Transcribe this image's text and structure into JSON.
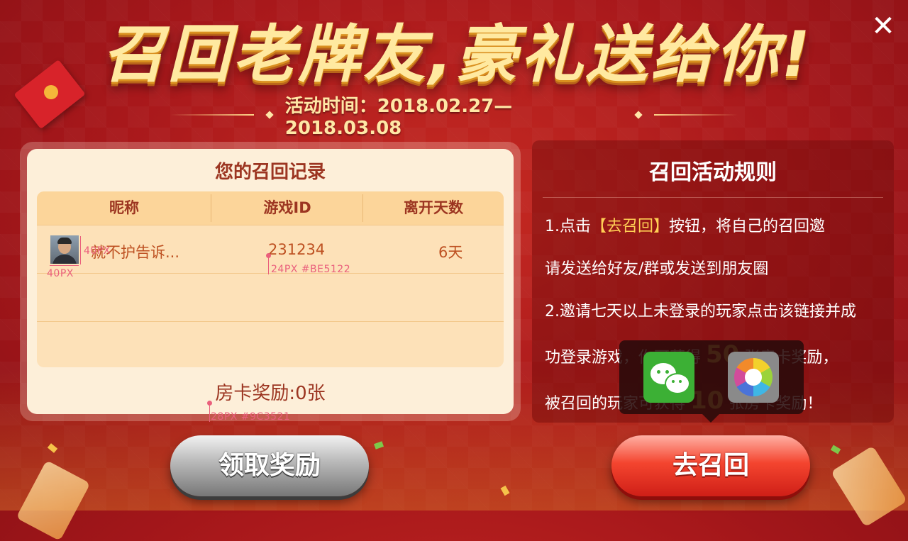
{
  "header": {
    "headline": "召回老牌友,豪礼送给你!",
    "date_text": "活动时间：2018.02.27—2018.03.08"
  },
  "close_icon": "close-icon",
  "record": {
    "title": "您的召回记录",
    "columns": [
      "昵称",
      "游戏ID",
      "离开天数"
    ],
    "rows": [
      {
        "name": "就不护告诉...",
        "id": "231234",
        "days": "6天"
      }
    ],
    "reward_text": "房卡奖励:0张"
  },
  "annotations": {
    "avatar_w": "40PX",
    "avatar_h": "40PX",
    "row_text": "24PX #BE5122",
    "reward_text": "28PX #9C3521"
  },
  "rules": {
    "title": "召回活动规则",
    "line1_a": "1.点击",
    "line1_hl": "【去召回】",
    "line1_b": "按钮，将自己的召回邀",
    "line2": "请发送给好友/群或发送到朋友圈",
    "line3": "2.邀请七天以上未登录的玩家点击该链接并成",
    "line4_a": "功登录游戏，你可获得 ",
    "line4_num": "50",
    "line4_b": " 张房卡奖励，",
    "line5_a": "被召回的玩家可获得 ",
    "line5_num": "10",
    "line5_b": " 张房卡奖励！"
  },
  "share": {
    "wechat_icon": "wechat-icon",
    "moments_icon": "moments-icon"
  },
  "buttons": {
    "claim": "领取奖励",
    "recall": "去召回"
  },
  "colors": {
    "accent_text": "#BE5122",
    "reward_text": "#9C3521",
    "highlight": "#FFCF55",
    "wechat_green": "#3CB035"
  }
}
